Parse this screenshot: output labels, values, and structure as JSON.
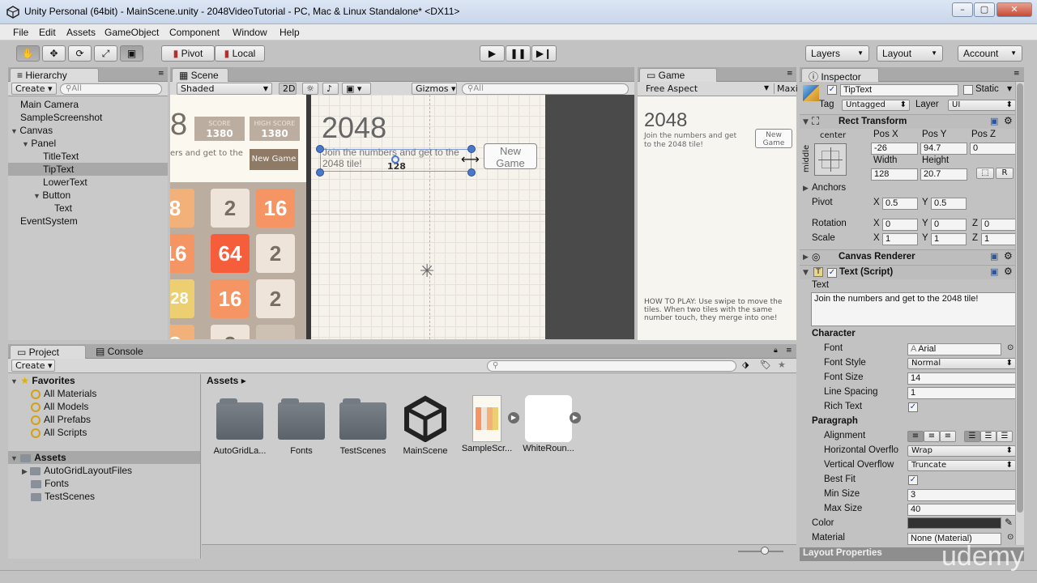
{
  "window": {
    "title": "Unity Personal (64bit) - MainScene.unity - 2048VideoTutorial - PC, Mac & Linux Standalone* <DX11>"
  },
  "menu": [
    "File",
    "Edit",
    "Assets",
    "GameObject",
    "Component",
    "Window",
    "Help"
  ],
  "toolbar": {
    "pivot": "Pivot",
    "local": "Local",
    "layers": "Layers",
    "layout": "Layout",
    "account": "Account"
  },
  "hierarchy": {
    "tab": "Hierarchy",
    "create": "Create",
    "search": "All",
    "items": [
      {
        "label": "Main Camera"
      },
      {
        "label": "SampleScreenshot"
      },
      {
        "label": "Canvas"
      },
      {
        "label": "Panel"
      },
      {
        "label": "TitleText"
      },
      {
        "label": "TipText"
      },
      {
        "label": "LowerText"
      },
      {
        "label": "Button"
      },
      {
        "label": "Text"
      },
      {
        "label": "EventSystem"
      }
    ]
  },
  "scene": {
    "tab": "Scene",
    "shading": "Shaded",
    "mode2d": "2D",
    "gizmos": "Gizmos",
    "search": "All",
    "title": "2048",
    "score_label": "SCORE",
    "score": "1380",
    "high_label": "HIGH SCORE",
    "high": "1380",
    "tip_partial": "ers and get to the",
    "new_game": "New Game",
    "tip_text": "Join the numbers and get to the 2048 tile!",
    "overlap": "128",
    "new_game_btn": "New\nGame",
    "tiles": [
      "8",
      "2",
      "16",
      "16",
      "64",
      "2",
      "128",
      "16",
      "2",
      "8",
      "2",
      ""
    ]
  },
  "game": {
    "tab": "Game",
    "aspect": "Free Aspect",
    "maxi": "Maxi",
    "title": "2048",
    "tip": "Join the numbers and get to the 2048 tile!",
    "new_game": "New\nGame",
    "howto": "HOW TO PLAY: Use swipe to move the tiles. When two tiles with the same number touch, they merge into one!"
  },
  "inspector": {
    "tab": "Inspector",
    "name": "TipText",
    "static": "Static",
    "tag_label": "Tag",
    "tag": "Untagged",
    "layer_label": "Layer",
    "layer": "UI",
    "rect": {
      "title": "Rect Transform",
      "anchor_h": "center",
      "anchor_v": "middle",
      "posx_label": "Pos X",
      "posx": "-26",
      "posy_label": "Pos Y",
      "posy": "94.7",
      "posz_label": "Pos Z",
      "posz": "0",
      "w_label": "Width",
      "w": "128",
      "h_label": "Height",
      "h": "20.7",
      "r": "R",
      "anchors": "Anchors",
      "pivot": "Pivot",
      "pivx": "0.5",
      "pivy": "0.5",
      "rotation": "Rotation",
      "rotx": "0",
      "roty": "0",
      "rotz": "0",
      "scale": "Scale",
      "sx": "1",
      "sy": "1",
      "sz": "1",
      "x": "X",
      "y": "Y",
      "z": "Z"
    },
    "canvas_renderer": "Canvas Renderer",
    "text": {
      "title": "Text (Script)",
      "text_label": "Text",
      "text": "Join the numbers and get to the 2048 tile!",
      "character": "Character",
      "font_label": "Font",
      "font": "Arial",
      "style_label": "Font Style",
      "style": "Normal",
      "size_label": "Font Size",
      "size": "14",
      "spacing_label": "Line Spacing",
      "spacing": "1",
      "rich_label": "Rich Text",
      "paragraph": "Paragraph",
      "align_label": "Alignment",
      "hover_label": "Horizontal Overflo",
      "hover": "Wrap",
      "vover_label": "Vertical Overflow",
      "vover": "Truncate",
      "bestfit_label": "Best Fit",
      "min_label": "Min Size",
      "min": "3",
      "max_label": "Max Size",
      "max": "40",
      "color_label": "Color",
      "material_label": "Material",
      "material": "None (Material)"
    },
    "layout_props": "Layout Properties"
  },
  "project": {
    "tab": "Project",
    "console_tab": "Console",
    "create": "Create",
    "favorites": "Favorites",
    "fav_items": [
      "All Materials",
      "All Models",
      "All Prefabs",
      "All Scripts"
    ],
    "assets_root": "Assets",
    "tree": [
      "AutoGridLayoutFiles",
      "Fonts",
      "TestScenes"
    ],
    "breadcrumb": "Assets",
    "assets": [
      "AutoGridLa...",
      "Fonts",
      "TestScenes",
      "MainScene",
      "SampleScr...",
      "WhiteRoun..."
    ]
  },
  "watermark": "udemy",
  "colors": {
    "tile8": "#f2b179",
    "tile2": "#eee4da",
    "tile16": "#f59563",
    "tile64": "#f65e3b",
    "tile128": "#edcf72",
    "selection": "#a8a8a8"
  }
}
